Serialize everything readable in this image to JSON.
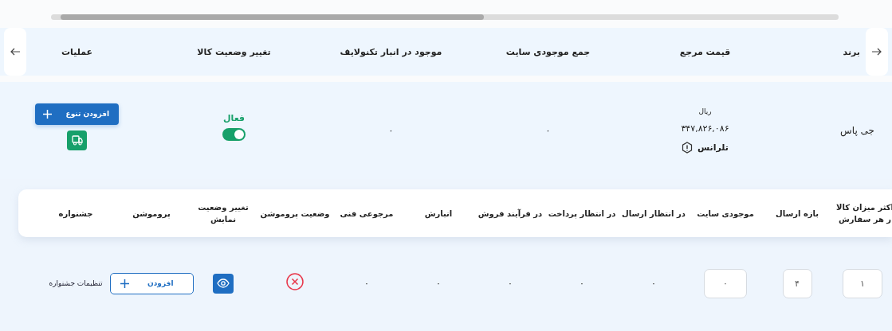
{
  "products_table": {
    "columns": [
      "برند",
      "قیمت مرجع",
      "جمع موجودی سایت",
      "موجود در انبار تکنولایف",
      "تغییر وضعیت کالا",
      "عملیات"
    ],
    "row": {
      "brand": "جی پاس",
      "price_unit": "ریال",
      "price": "۳۴۷,۸۲۶,۰۸۶",
      "tolerance": "تلرانس",
      "site_stock_total": "۰",
      "warehouse_stock": "۰",
      "status": {
        "label": "فعال",
        "on": true
      },
      "add_variant_button": "افزودن تنوع"
    }
  },
  "variants_table": {
    "columns": [
      "اکثر میزان کالا ر هر سفارش",
      "بازه ارسال",
      "موجودی سایت",
      "در انتظار ارسال",
      "در انتظار پرداخت",
      "در فرآیند فروش",
      "انبارش",
      "مرجوعی فنی",
      "وضعیت پروموشن",
      "تغییر وضعیت نمایش",
      "پروموشن",
      "جشنواره"
    ],
    "row": {
      "max_per_order": "۱",
      "shipping_period": "۴",
      "site_stock": "۰",
      "awaiting_shipment": "۰",
      "awaiting_payment": "۰",
      "in_sale_process": "۰",
      "warehouse": "۰",
      "technical_returns": "۰",
      "promotion_active": false,
      "visible": true,
      "add_promotion_button": "افزودن",
      "festival_link": "تنظیمات جشنواره"
    }
  }
}
